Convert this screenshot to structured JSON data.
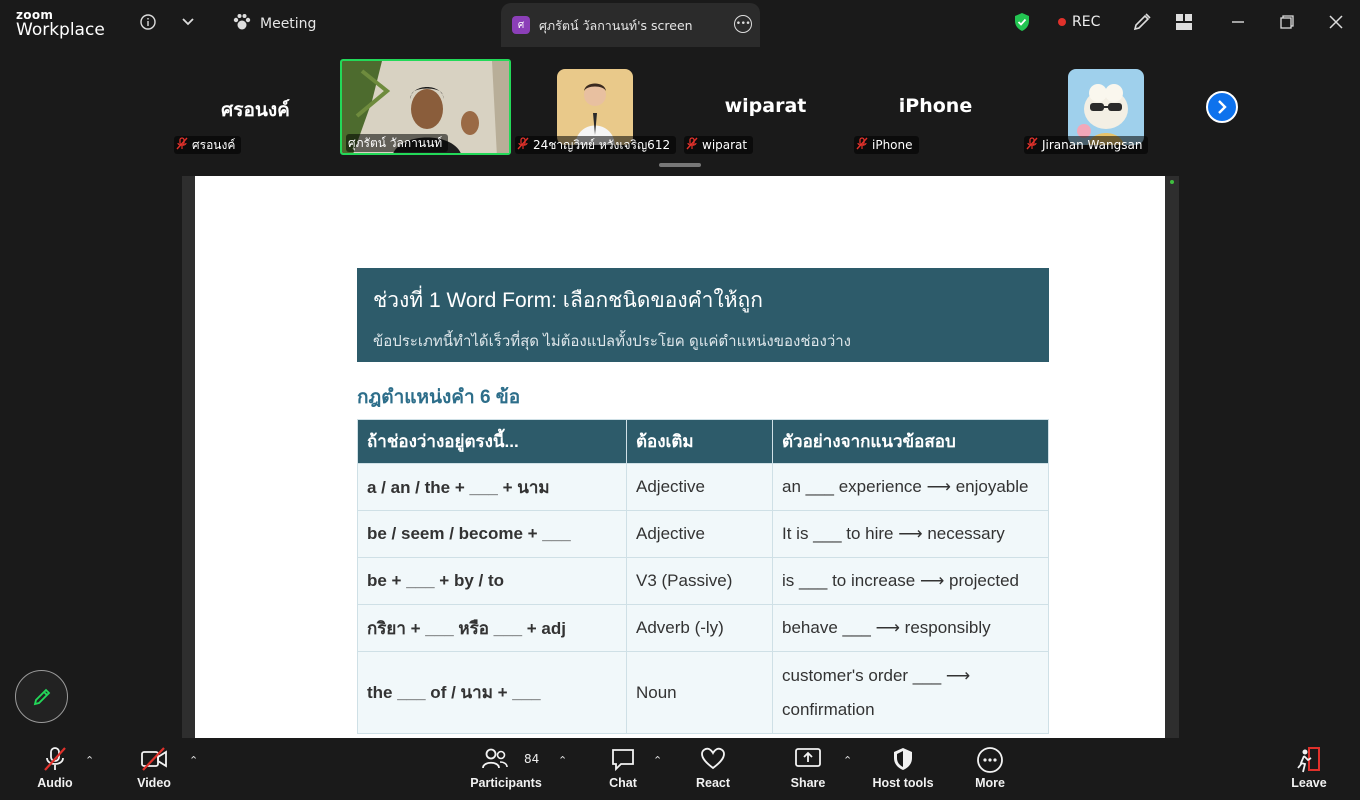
{
  "topbar": {
    "brand_line1": "zoom",
    "brand_line2": "Workplace",
    "meeting_label": "Meeting",
    "share_badge": "ศ",
    "share_title": "ศุภรัตน์ วัลกานนท์'s screen",
    "rec_label": "REC"
  },
  "participants": [
    {
      "display": "ศรอนงค์",
      "label": "ศรอนงค์",
      "muted": true
    },
    {
      "display": "",
      "label": "ศุภรัตน์ วัลกานนท์",
      "muted": false,
      "video": true
    },
    {
      "display": "",
      "label": "24ชาญวิทย์ หวังเจริญ612",
      "muted": true
    },
    {
      "display": "wiparat",
      "label": "wiparat",
      "muted": true
    },
    {
      "display": "iPhone",
      "label": "iPhone",
      "muted": true
    },
    {
      "display": "",
      "label": "Jiranan Wangsan",
      "muted": true
    }
  ],
  "slide": {
    "title": "ช่วงที่ 1  Word Form: เลือกชนิดของคำให้ถูก",
    "subtitle": "ข้อประเภทนี้ทำได้เร็วที่สุด ไม่ต้องแปลทั้งประโยค ดูแค่ตำแหน่งของช่องว่าง",
    "rule_title": "กฎตำแหน่งคำ 6 ข้อ",
    "table": {
      "headers": [
        "ถ้าช่องว่างอยู่ตรงนี้...",
        "ต้องเติม",
        "ตัวอย่างจากแนวข้อสอบ"
      ],
      "rows": [
        [
          "a / an / the + ___ + นาม",
          "Adjective",
          "an ___ experience ⟶ enjoyable"
        ],
        [
          "be / seem / become + ___",
          "Adjective",
          "It is ___ to hire ⟶ necessary"
        ],
        [
          "be + ___ + by / to",
          "V3 (Passive)",
          "is ___ to increase ⟶ projected"
        ],
        [
          "กริยา + ___  หรือ  ___ + adj",
          "Adverb (-ly)",
          "behave ___ ⟶ responsibly"
        ],
        [
          "the ___ of  /  นาม + ___",
          "Noun",
          "customer's order ___ ⟶ confirmation"
        ]
      ]
    }
  },
  "toolbar": {
    "audio": "Audio",
    "video": "Video",
    "participants": "Participants",
    "participant_count": "84",
    "chat": "Chat",
    "react": "React",
    "share": "Share",
    "host_tools": "Host tools",
    "more": "More",
    "leave": "Leave"
  },
  "colors": {
    "accent_blue": "#0e72ed",
    "active_speaker": "#23d959",
    "rec_red": "#e0312b",
    "slide_header": "#2d5b6a"
  }
}
